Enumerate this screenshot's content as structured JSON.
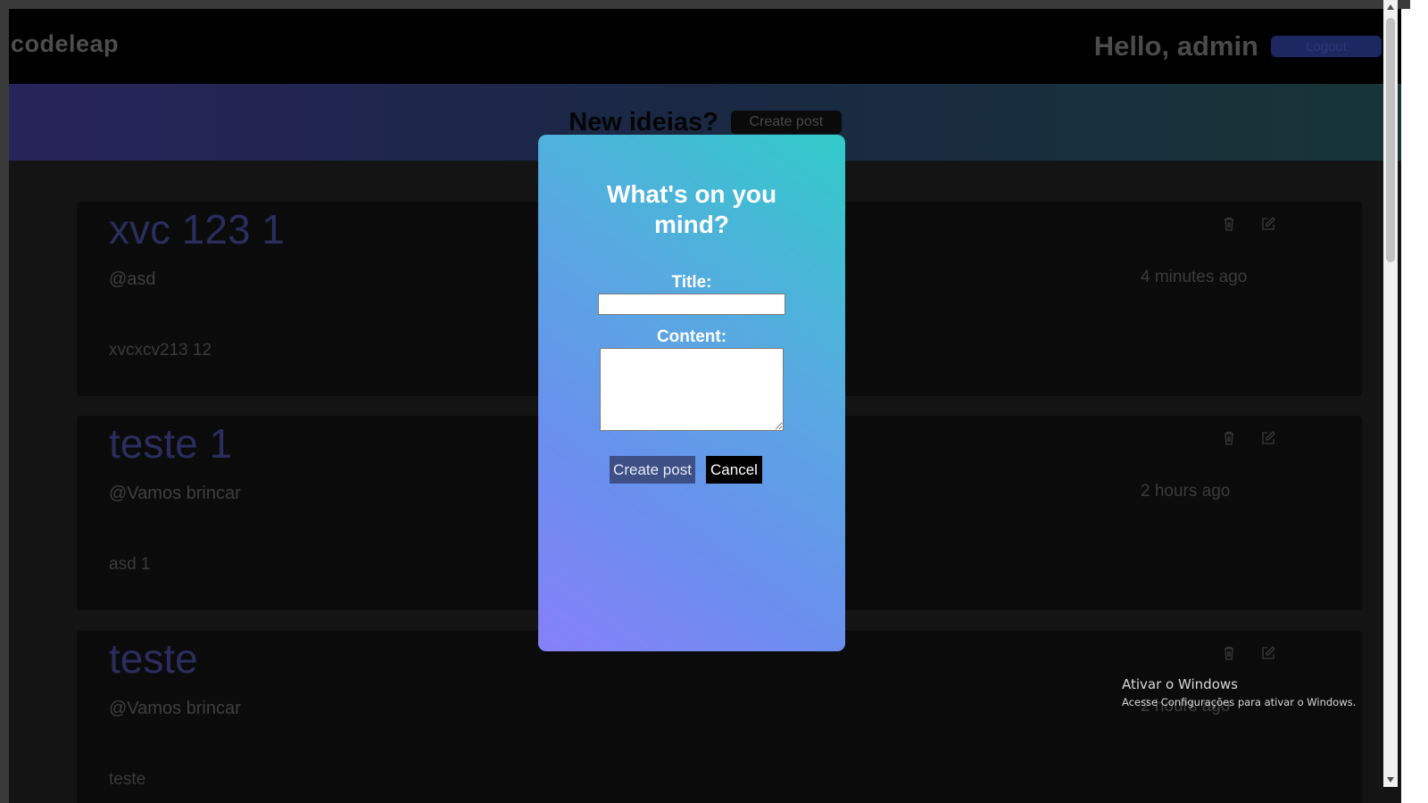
{
  "header": {
    "logo": "codeleap",
    "greeting": "Hello, admin",
    "logout_label": "Logout"
  },
  "banner": {
    "title": "New ideias?",
    "create_label": "Create post"
  },
  "posts": [
    {
      "title": "xvc 123 1",
      "author": "@asd",
      "time": "4 minutes ago",
      "content": "xvcxcv213 12"
    },
    {
      "title": "teste 1",
      "author": "@Vamos brincar",
      "time": "2 hours ago",
      "content": "asd 1"
    },
    {
      "title": "teste",
      "author": "@Vamos brincar",
      "time": "2 hours ago",
      "content": "teste"
    }
  ],
  "modal": {
    "title": "What's on you mind?",
    "title_label": "Title:",
    "title_value": "",
    "content_label": "Content:",
    "content_value": "",
    "create_label": "Create post",
    "cancel_label": "Cancel"
  },
  "watermark": {
    "title": "Ativar o Windows",
    "subtitle": "Acesse Configurações para ativar o Windows."
  },
  "colors": {
    "accent": "#3e4f86",
    "post_title": "#2a2d5e",
    "modal_gradient_top": "#31cbc9",
    "modal_gradient_bottom": "#8680f8"
  },
  "icons": {
    "trash": "trash-icon",
    "edit": "edit-icon"
  }
}
